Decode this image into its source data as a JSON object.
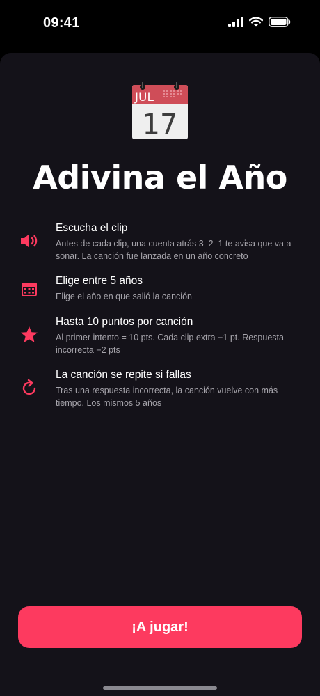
{
  "status_bar": {
    "time": "09:41"
  },
  "hero": {
    "icon": "calendar-emoji-icon",
    "month": "JUL",
    "day": "17"
  },
  "title": "Adivina el Año",
  "rules": [
    {
      "icon": "speaker-icon",
      "title": "Escucha el clip",
      "description": "Antes de cada clip, una cuenta atrás 3–2–1 te avisa que va a sonar. La canción fue lanzada en un año concreto"
    },
    {
      "icon": "calendar-icon",
      "title": "Elige entre 5 años",
      "description": "Elige el año en que salió la canción"
    },
    {
      "icon": "star-icon",
      "title": "Hasta 10 puntos por canción",
      "description": "Al primer intento = 10 pts. Cada clip extra −1 pt. Respuesta incorrecta −2 pts"
    },
    {
      "icon": "repeat-icon",
      "title": "La canción se repite si fallas",
      "description": "Tras una respuesta incorrecta, la canción vuelve con más tiempo. Los mismos 5 años"
    }
  ],
  "cta": {
    "label": "¡A jugar!"
  },
  "colors": {
    "accent": "#fd3a5f",
    "sheet_background": "#141219",
    "secondary_text": "#a6a4ab"
  }
}
